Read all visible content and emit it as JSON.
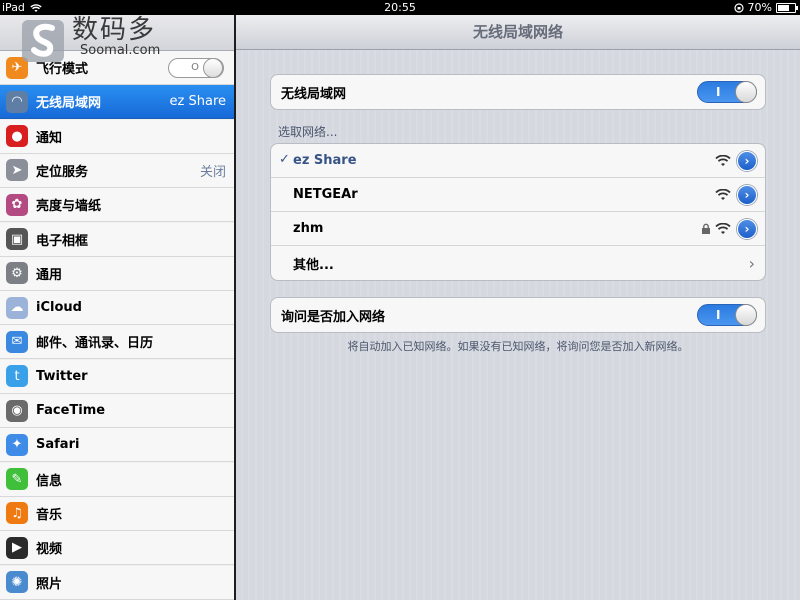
{
  "status_bar": {
    "device": "iPad",
    "time": "20:55",
    "battery": "70%",
    "battery_level": 0.7
  },
  "logo": {
    "text": "数码多",
    "sub": "Soomal.com"
  },
  "sidebar": {
    "items": [
      {
        "label": "飞行模式",
        "value": "",
        "icon": "airplane-icon",
        "color": "#f08a1e",
        "control": "toggle-off"
      },
      {
        "label": "无线局域网",
        "value": "ez Share",
        "icon": "wifi-icon",
        "color": "#5f7ea6",
        "selected": true
      },
      {
        "label": "通知",
        "value": "",
        "icon": "notification-icon",
        "color": "#d81e1e"
      },
      {
        "label": "定位服务",
        "value": "关闭",
        "icon": "location-icon",
        "color": "#8a8f99"
      },
      {
        "label": "亮度与墙纸",
        "value": "",
        "icon": "flower-icon",
        "color": "#b34a82"
      },
      {
        "label": "电子相框",
        "value": "",
        "icon": "picture-frame-icon",
        "color": "#555"
      },
      {
        "label": "通用",
        "value": "",
        "icon": "gear-icon",
        "color": "#7d7f86"
      },
      {
        "label": "iCloud",
        "value": "",
        "icon": "cloud-icon",
        "color": "#9bb3d8"
      },
      {
        "label": "邮件、通讯录、日历",
        "value": "",
        "icon": "mail-icon",
        "color": "#3a88e0"
      },
      {
        "label": "Twitter",
        "value": "",
        "icon": "twitter-icon",
        "color": "#3aa0e8"
      },
      {
        "label": "FaceTime",
        "value": "",
        "icon": "camera-icon",
        "color": "#6a6a6a"
      },
      {
        "label": "Safari",
        "value": "",
        "icon": "compass-icon",
        "color": "#3f8ce8"
      },
      {
        "label": "信息",
        "value": "",
        "icon": "message-icon",
        "color": "#3fbf3a"
      },
      {
        "label": "音乐",
        "value": "",
        "icon": "music-icon",
        "color": "#f07a12"
      },
      {
        "label": "视频",
        "value": "",
        "icon": "video-icon",
        "color": "#2a2a2a"
      },
      {
        "label": "照片",
        "value": "",
        "icon": "sunflower-icon",
        "color": "#4a8bd0"
      }
    ]
  },
  "main": {
    "title": "无线局域网络",
    "wifi_toggle_label": "无线局域网",
    "wifi_toggle_text": "I",
    "choose_network": "选取网络...",
    "checkmark": "✓",
    "networks": [
      {
        "name": "ez Share",
        "selected": true,
        "locked": false
      },
      {
        "name": "NETGEAr",
        "selected": false,
        "locked": false
      },
      {
        "name": "zhm",
        "selected": false,
        "locked": true
      }
    ],
    "other": "其他...",
    "ask_label": "询问是否加入网络",
    "ask_toggle_text": "I",
    "ask_note": "将自动加入已知网络。如果没有已知网络，将询问您是否加入新网络。"
  }
}
